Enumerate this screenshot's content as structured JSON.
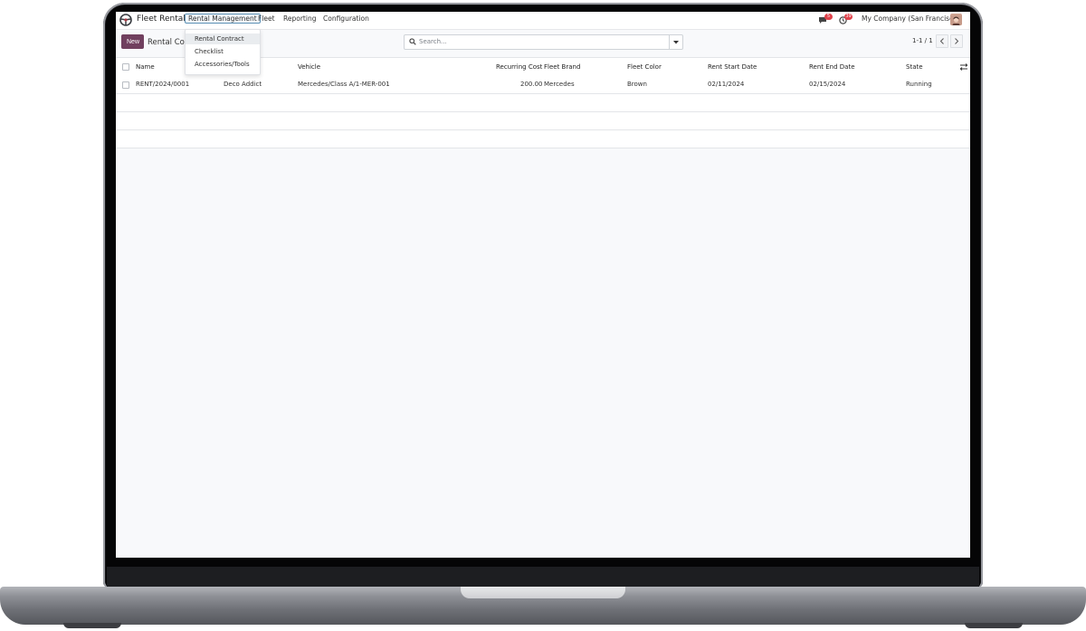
{
  "navbar": {
    "app_name": "Fleet Rental",
    "menus": [
      "Rental Management",
      "Fleet",
      "Reporting",
      "Configuration"
    ],
    "chat_badge": "5",
    "activity_badge": "39",
    "company": "My Company (San Francisco)",
    "icons": [
      "steering-wheel-icon",
      "chat-icon",
      "clock-icon"
    ]
  },
  "dropdown": {
    "items": [
      "Rental Contract",
      "Checklist",
      "Accessories/Tools"
    ]
  },
  "control": {
    "new_label": "New",
    "breadcrumb": "Rental Contract",
    "search_placeholder": "Search...",
    "pager": "1-1 / 1"
  },
  "table": {
    "columns": [
      "Name",
      "Vehicle",
      "Recurring Cost",
      "Fleet Brand",
      "Fleet Color",
      "Rent Start Date",
      "Rent End Date",
      "State"
    ],
    "rows": [
      {
        "name": "RENT/2024/0001",
        "customer": "Deco Addict",
        "vehicle": "Mercedes/Class A/1-MER-001",
        "recurring_cost": "200.00",
        "fleet_brand": "Mercedes",
        "fleet_color": "Brown",
        "rent_start_date": "02/11/2024",
        "rent_end_date": "02/15/2024",
        "state": "Running"
      }
    ]
  },
  "colors": {
    "brand": "#71405f",
    "badge": "#e0424b",
    "active_menu_border": "#5a8fb4"
  }
}
